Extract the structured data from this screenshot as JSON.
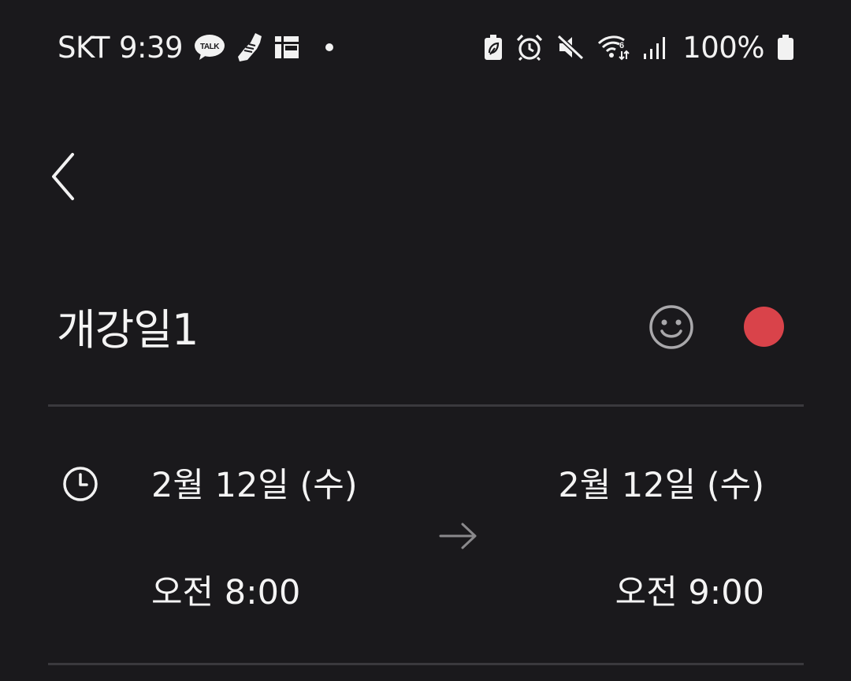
{
  "status_bar": {
    "carrier": "SKT",
    "time": "9:39",
    "notification_icons": [
      "kakaotalk-icon",
      "shoe-icon",
      "grid-app-icon",
      "dot-icon"
    ],
    "talk_badge_text": "TALK",
    "system_icons": [
      "battery-saver-icon",
      "alarm-icon",
      "mute-icon",
      "wifi-icon",
      "signal-icon"
    ],
    "battery_percent": "100%"
  },
  "header": {
    "back_icon": "chevron-left-icon"
  },
  "event": {
    "title": "개강일1",
    "emoji_icon": "smiley-icon",
    "color": "#d9434a"
  },
  "time_section": {
    "icon": "clock-icon",
    "start_date": "2월 12일 (수)",
    "start_time": "오전 8:00",
    "arrow_icon": "arrow-right-icon",
    "end_date": "2월 12일 (수)",
    "end_time": "오전 9:00"
  },
  "colors": {
    "background": "#1a191c",
    "text": "#f4f4f4",
    "divider": "#3a393d",
    "accent_red": "#d9434a",
    "muted_icon": "#8a898c"
  }
}
